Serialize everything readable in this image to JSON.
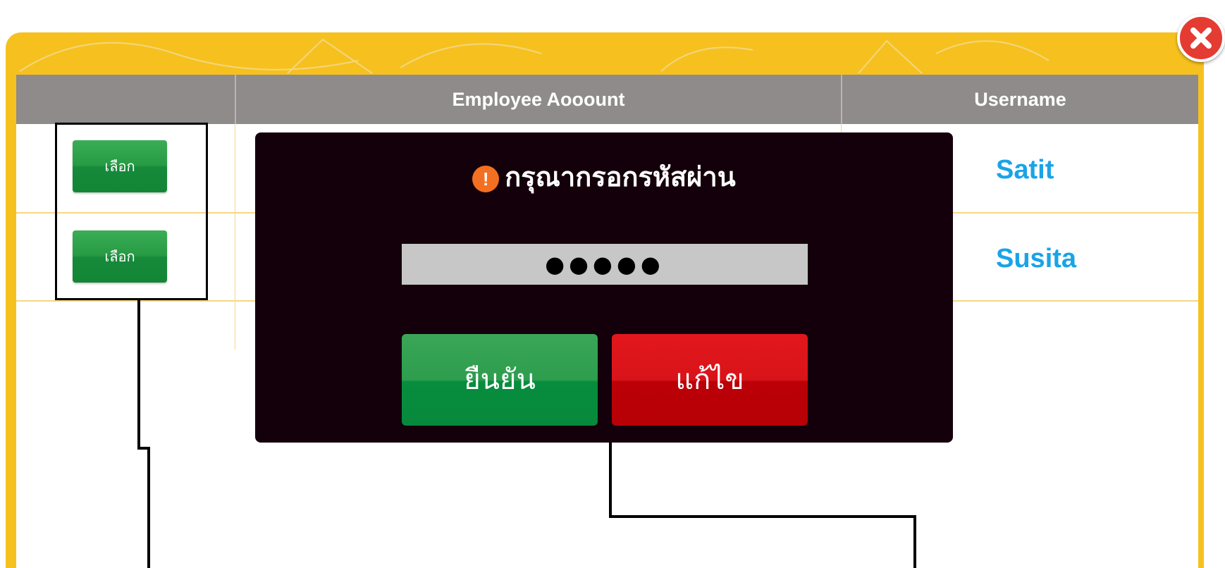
{
  "table": {
    "headers": [
      "",
      "Employee Aooount",
      "Username"
    ],
    "rows": [
      {
        "action_label": "เลือก",
        "username": "Satit"
      },
      {
        "action_label": "เลือก",
        "username": "Susita"
      }
    ]
  },
  "dialog": {
    "title": "กรุณากรอกรหัสผ่าน",
    "password_value": "●●●●●",
    "confirm_label": "ยืนยัน",
    "edit_label": "แก้ไข"
  },
  "colors": {
    "frame": "#f6c11f",
    "header": "#8f8b8b",
    "select_button": "#279a44",
    "username_text": "#1aa3e8",
    "dialog_bg": "#14000a",
    "confirm_button": "#2e9d4e",
    "edit_button": "#d81419",
    "close_button": "#e43c33"
  },
  "icons": [
    "close-icon",
    "warning-icon"
  ]
}
